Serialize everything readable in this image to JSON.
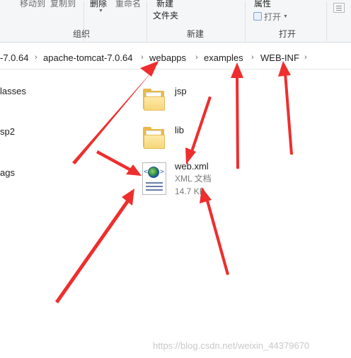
{
  "ribbon": {
    "move_to": "移动到",
    "copy_to": "复制到",
    "delete": "删除",
    "rename": "重命名",
    "new_top": "新建",
    "new_folder": "文件夹",
    "properties": "属性",
    "open": "打开",
    "groups": {
      "organize": "组织",
      "new": "新建",
      "open": "打开"
    }
  },
  "address": {
    "crumbs": [
      "-7.0.64",
      "apache-tomcat-7.0.64",
      "webapps",
      "examples",
      "WEB-INF"
    ],
    "separator": "›"
  },
  "tree": [
    "lasses",
    "sp2",
    "ags"
  ],
  "files": [
    {
      "name": "jsp",
      "type": "folder"
    },
    {
      "name": "lib",
      "type": "folder"
    },
    {
      "name": "web.xml",
      "type_label": "XML 文档",
      "size": "14.7 KB"
    }
  ],
  "icons": {
    "folder": "folder-icon",
    "xml": "xml-file-icon",
    "open": "open-icon",
    "dropdown": "chevron-down-icon"
  },
  "colors": {
    "arrow": "#ee2e2e",
    "folder": "#f7d67c"
  },
  "watermark": "https://blog.csdn.net/weixin_44379670"
}
